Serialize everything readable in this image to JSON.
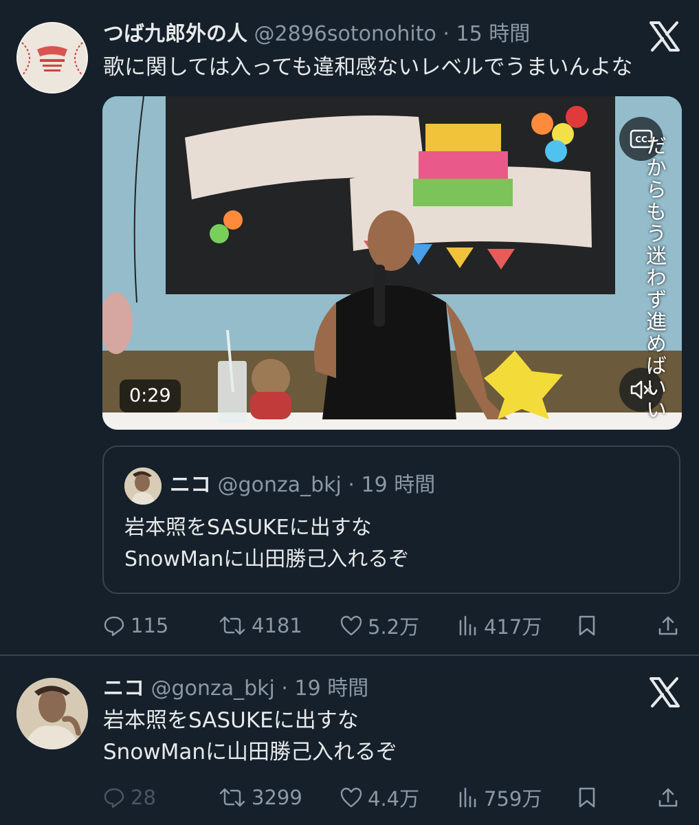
{
  "post1": {
    "author_name": "つば九郎外の人",
    "handle": "@2896sotonohito",
    "separator": "·",
    "time": "15 時間",
    "text": "歌に関しては入っても違和感ないレベルでうまいんよな",
    "video": {
      "duration": "0:29",
      "caption_overlay": "だからもう迷わず進めばいい",
      "cc_icon": "closed-captions-icon",
      "mute_icon": "muted-speaker-icon"
    },
    "quote": {
      "author_name": "ニコ",
      "handle": "@gonza_bkj",
      "separator": "·",
      "time": "19 時間",
      "line1": "岩本照をSASUKEに出すな",
      "line2": "SnowManに山田勝己入れるぞ"
    },
    "stats": {
      "replies": "115",
      "reposts": "4181",
      "likes": "5.2万",
      "views": "417万"
    }
  },
  "post2": {
    "author_name": "ニコ",
    "handle": "@gonza_bkj",
    "separator": "·",
    "time": "19 時間",
    "line1": "岩本照をSASUKEに出すな",
    "line2": "SnowManに山田勝己入れるぞ",
    "stats": {
      "replies": "28",
      "reposts": "3299",
      "likes": "4.4万",
      "views": "759万"
    }
  },
  "icons": {
    "reply": "speech-bubble-icon",
    "repost": "repost-arrows-icon",
    "like": "heart-icon",
    "views": "bar-chart-icon",
    "bookmark": "bookmark-icon",
    "share": "share-upload-icon",
    "x_logo": "x-logo-icon"
  },
  "colors": {
    "background": "#15202b",
    "primary_text": "#e7e9ea",
    "secondary_text": "#8b98a5",
    "border": "#38444d"
  }
}
